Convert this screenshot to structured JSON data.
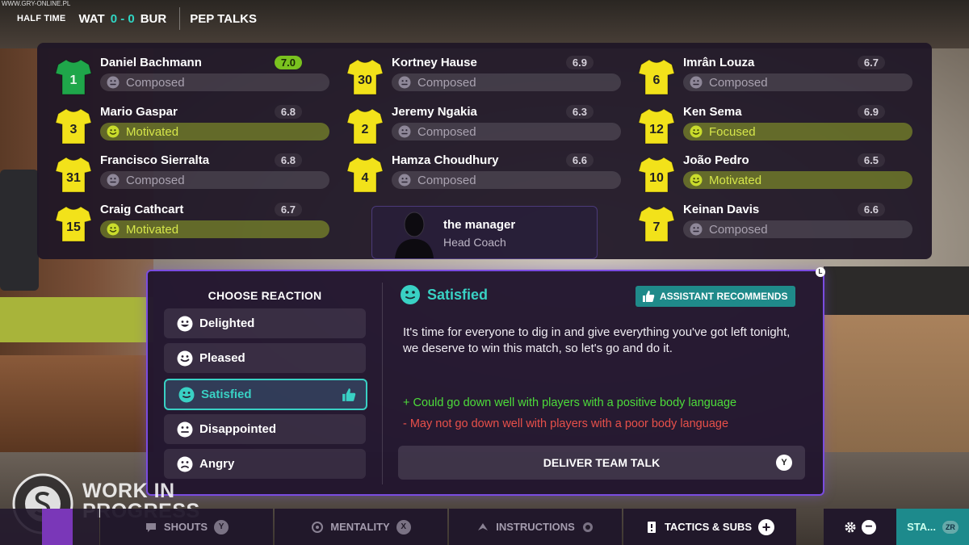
{
  "site_watermark": "WWW.GRY-ONLINE.PL",
  "topbar": {
    "period": "HALF TIME",
    "home": "WAT",
    "score": "0 - 0",
    "away": "BUR",
    "title": "PEP TALKS"
  },
  "colors": {
    "accent_teal": "#39d1c4",
    "positive": "#4ddc3a",
    "negative": "#e8504a",
    "dialog_border": "#7a4ce0",
    "shirt_keeper": "#1fa64a",
    "shirt_outfield": "#f2e21a"
  },
  "players": [
    {
      "number": "1",
      "name": "Daniel Bachmann",
      "rating": "7.0",
      "mood": "Composed",
      "keeper": true
    },
    {
      "number": "3",
      "name": "Mario Gaspar",
      "rating": "6.8",
      "mood": "Motivated"
    },
    {
      "number": "31",
      "name": "Francisco Sierralta",
      "rating": "6.8",
      "mood": "Composed"
    },
    {
      "number": "15",
      "name": "Craig Cathcart",
      "rating": "6.7",
      "mood": "Motivated"
    },
    {
      "number": "30",
      "name": "Kortney Hause",
      "rating": "6.9",
      "mood": "Composed"
    },
    {
      "number": "2",
      "name": "Jeremy Ngakia",
      "rating": "6.3",
      "mood": "Composed"
    },
    {
      "number": "4",
      "name": "Hamza Choudhury",
      "rating": "6.6",
      "mood": "Composed"
    },
    {
      "number": "6",
      "name": "Imrân Louza",
      "rating": "6.7",
      "mood": "Composed"
    },
    {
      "number": "12",
      "name": "Ken Sema",
      "rating": "6.9",
      "mood": "Focused"
    },
    {
      "number": "10",
      "name": "João Pedro",
      "rating": "6.5",
      "mood": "Motivated"
    },
    {
      "number": "7",
      "name": "Keinan Davis",
      "rating": "6.6",
      "mood": "Composed"
    }
  ],
  "manager": {
    "name": "the manager",
    "role": "Head Coach"
  },
  "dialog": {
    "choose_title": "CHOOSE REACTION",
    "reactions": [
      {
        "label": "Delighted",
        "icon": "delighted-face-icon"
      },
      {
        "label": "Pleased",
        "icon": "pleased-face-icon"
      },
      {
        "label": "Satisfied",
        "icon": "satisfied-face-icon",
        "selected": true
      },
      {
        "label": "Disappointed",
        "icon": "disappointed-face-icon"
      },
      {
        "label": "Angry",
        "icon": "angry-face-icon"
      }
    ],
    "selected_title": "Satisfied",
    "assistant_label": "ASSISTANT RECOMMENDS",
    "talk_text": "It's time for everyone to dig in and give everything you've got left tonight, we deserve to win this match, so let's go and do it.",
    "pro": "+ Could go down well with players with a positive body language",
    "con": "- May not go down well with players with a poor body language",
    "deliver_label": "DELIVER TEAM TALK",
    "deliver_key": "Y",
    "corner_key": "L"
  },
  "watermark": {
    "line1": "WORK IN",
    "line2": "PROGRESS",
    "logo_text": "SPORTS INTERACTIVE"
  },
  "bottombar": {
    "shouts": "SHOUTS",
    "shouts_key": "Y",
    "mentality": "MENTALITY",
    "mentality_key": "X",
    "instructions": "INSTRUCTIONS",
    "tactics": "TACTICS & SUBS",
    "stats": "STA...",
    "stats_key": "ZR"
  }
}
